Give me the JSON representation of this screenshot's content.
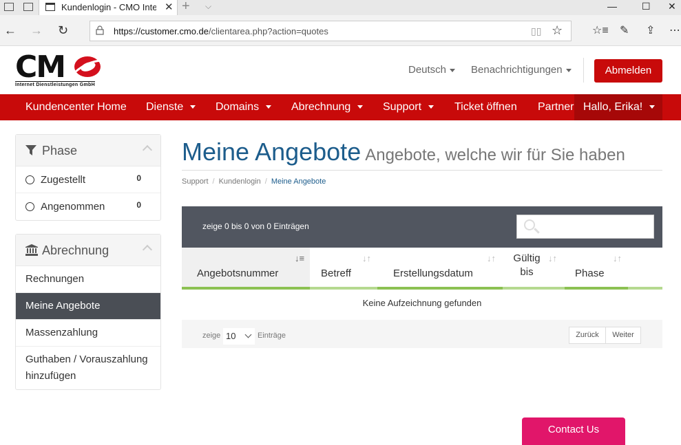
{
  "browser": {
    "tab_title": "Kundenlogin - CMO Internet",
    "tab_close": "✕",
    "url_host": "https://customer.cmo.de",
    "url_path": "/clientarea.php?action=quotes"
  },
  "header": {
    "logo_text": "CM",
    "logo_sub": "Internet Dienstleistungen GmbH",
    "lang": "Deutsch",
    "notifications": "Benachrichtigungen",
    "logout": "Abmelden"
  },
  "nav": {
    "items": [
      "Kundencenter Home",
      "Dienste",
      "Domains",
      "Abrechnung",
      "Support",
      "Ticket öffnen",
      "Partner"
    ],
    "hallo": "Hallo, Erika!"
  },
  "sidebar": {
    "phase_title": "Phase",
    "phase_rows": [
      {
        "label": "Zugestellt",
        "count": "0"
      },
      {
        "label": "Angenommen",
        "count": "0"
      }
    ],
    "billing_title": "Abrechnung",
    "billing_links": [
      "Rechnungen",
      "Meine Angebote",
      "Massenzahlung",
      "Guthaben / Vorauszahlung hinzufügen"
    ]
  },
  "main": {
    "title": "Meine Angebote",
    "subtitle": "Angebote, welche wir für Sie haben",
    "breadcrumb": [
      "Support",
      "Kundenlogin",
      "Meine Angebote"
    ],
    "table_info": "zeige 0 bis 0 von 0 Einträgen",
    "columns": [
      "Angebotsnummer",
      "Betreff",
      "Erstellungsdatum",
      "Gültig bis",
      "Phase"
    ],
    "col_gueltig_1": "Gültig",
    "col_gueltig_2": "bis",
    "empty": "Keine Aufzeichnung gefunden",
    "show_label": "zeige",
    "page_size": "10",
    "entries_label": "Einträge",
    "prev": "Zurück",
    "next": "Weiter"
  },
  "contact": "Contact Us",
  "colors": {
    "brand_red": "#c80a0a",
    "title_blue": "#1d5d8c",
    "green": "#8cc152",
    "contact_pink": "#e1166a"
  }
}
